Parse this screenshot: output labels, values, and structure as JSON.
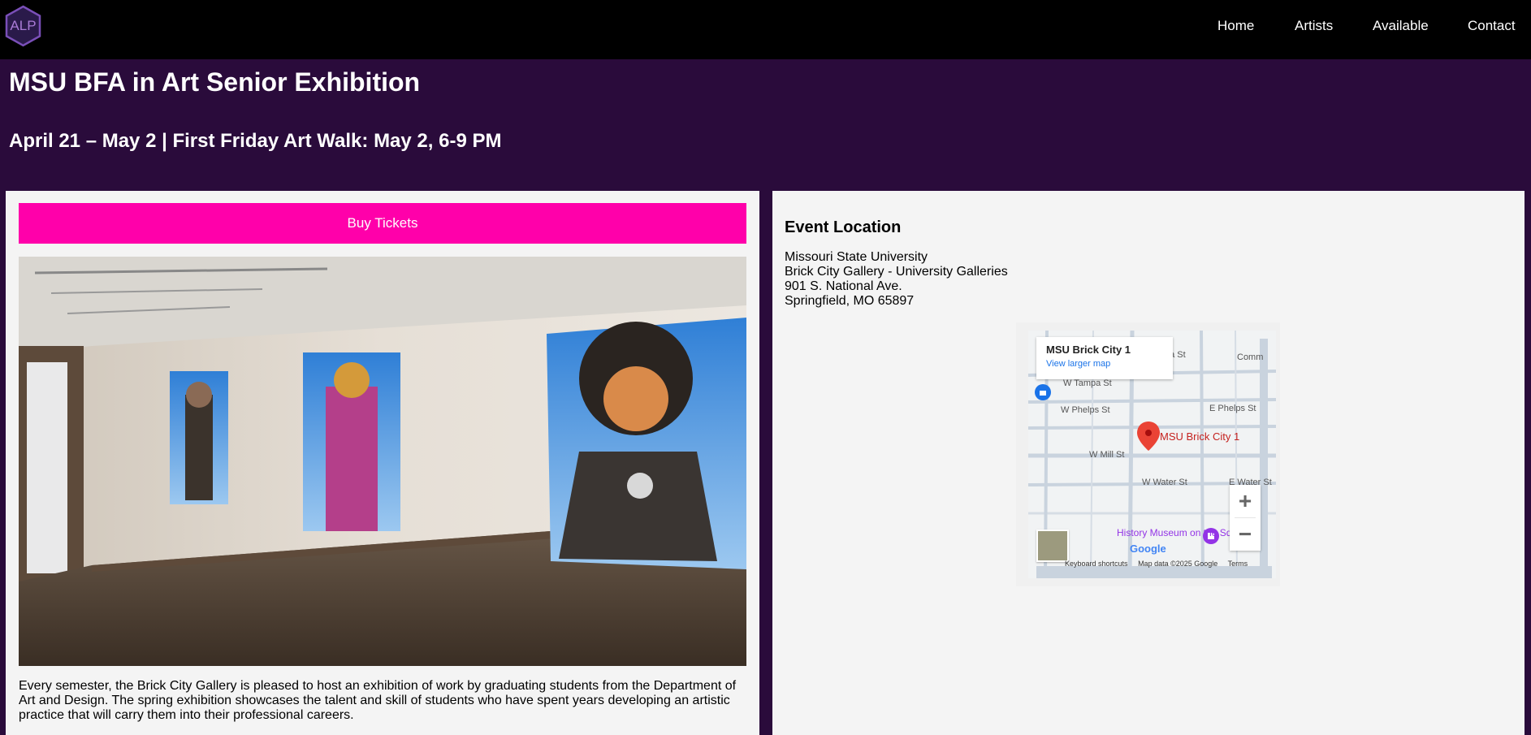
{
  "header": {
    "logo_text": "ALP",
    "nav": [
      "Home",
      "Artists",
      "Available",
      "Contact"
    ]
  },
  "event": {
    "title": "MSU BFA in Art Senior Exhibition",
    "dates": "April 21 – May 2 | First Friday Art Walk: May 2, 6-9 PM",
    "buy_label": "Buy Tickets",
    "description": "Every semester, the Brick City Gallery is pleased to host an exhibition of work by graduating students from the Department of Art and Design. The spring exhibition showcases the talent and skill of students who have spent years developing an artistic practice that will carry them into their professional careers."
  },
  "location": {
    "heading": "Event Location",
    "lines": [
      "Missouri State University",
      "Brick City Gallery - University Galleries",
      "901 S. National Ave.",
      "Springfield, MO 65897"
    ]
  },
  "map": {
    "card_title": "MSU Brick City 1",
    "card_link": "View larger map",
    "pin_label": "MSU Brick City 1",
    "streets": [
      "W Tampa St",
      "W Phelps St",
      "E Phelps St",
      "W Mill St",
      "W Water St",
      "E Water St",
      "pa St",
      "Comm"
    ],
    "poi": "History Museum on the Square",
    "footer": [
      "Keyboard shortcuts",
      "Map data ©2025 Google",
      "Terms"
    ],
    "google": "Google",
    "zoom_in": "+",
    "zoom_out": "−"
  },
  "colors": {
    "page_bg": "#2a0b3b",
    "topbar": "#000000",
    "buy_button": "#ff00aa",
    "panel": "#f4f4f4"
  }
}
